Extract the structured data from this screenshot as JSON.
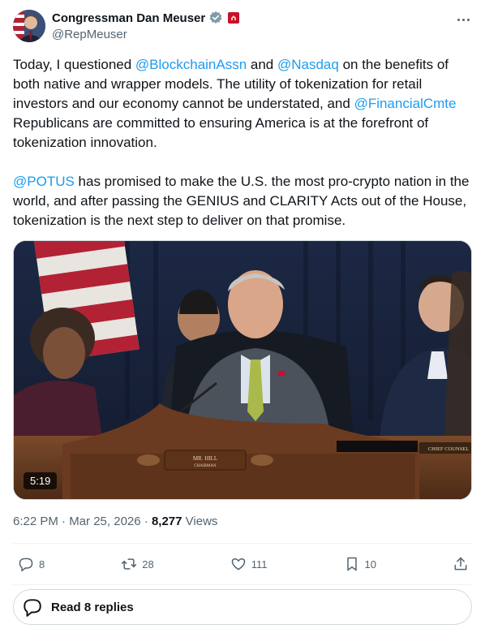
{
  "author": {
    "display_name": "Congressman Dan Meuser",
    "handle": "@RepMeuser",
    "verified_icon": "verified-badge-icon",
    "affiliation_icon": "government-badge-icon"
  },
  "tweet": {
    "p1": {
      "t1": "Today, I questioned ",
      "m1": "@BlockchainAssn",
      "t2": " and ",
      "m2": "@Nasdaq",
      "t3": " on the benefits of both native and wrapper models. The utility of tokenization for retail investors and our economy cannot be understated, and ",
      "m3": "@FinancialCmte",
      "t4": " Republicans are committed to ensuring America is at the forefront of tokenization innovation."
    },
    "p2": {
      "m1": "@POTUS",
      "t1": " has promised to make the U.S. the most pro-crypto nation in the world, and after passing the GENIUS and CLARITY Acts out of the House, tokenization is the next step to deliver on that promise."
    }
  },
  "media": {
    "duration": "5:19",
    "nameplate_name": "MR. HILL",
    "nameplate_title": "CHAIRMAN",
    "right_placard": "CHIEF COUNSEL"
  },
  "meta": {
    "time": "6:22 PM",
    "separator": " · ",
    "date": "Mar 25, 2026",
    "views_count": "8,277",
    "views_label": " Views"
  },
  "actions": {
    "replies": "8",
    "reposts": "28",
    "likes": "111",
    "bookmarks": "10"
  },
  "read_replies_label": "Read 8 replies",
  "colors": {
    "link": "#1d9bf0",
    "secondary_text": "#536471",
    "primary_text": "#0f1419"
  }
}
